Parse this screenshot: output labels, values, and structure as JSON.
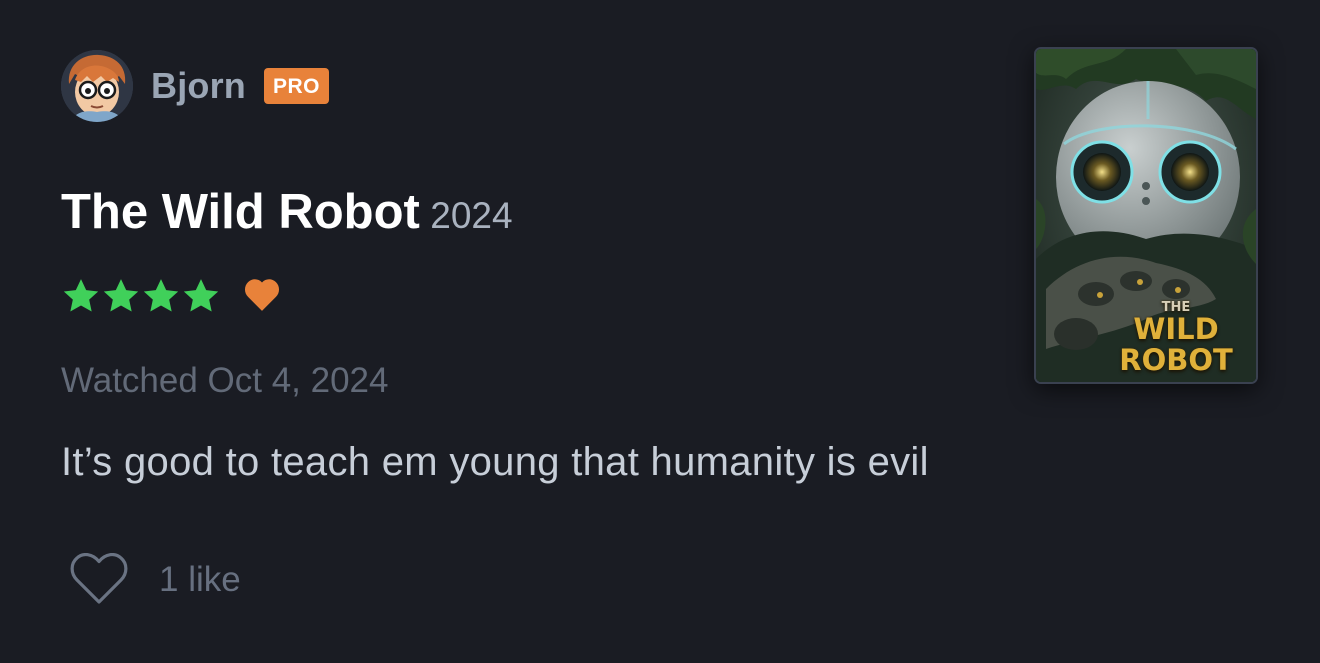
{
  "author": {
    "username": "Bjorn",
    "badge": "PRO",
    "avatar_icon": "avatar-cartoon-face",
    "badge_color": "#e8823a"
  },
  "film": {
    "title": "The Wild Robot",
    "year": "2024",
    "poster": {
      "title_line1": "THE",
      "title_line2": "WILD",
      "title_line3": "ROBOT"
    }
  },
  "rating": {
    "stars": 4,
    "max_stars": 5,
    "star_color": "#40d05a",
    "liked": true,
    "heart_color": "#e8823a"
  },
  "watched": {
    "text": "Watched Oct 4, 2024"
  },
  "review": {
    "body": "It’s good to teach em young that humanity is evil"
  },
  "likes": {
    "count_text": "1 like"
  },
  "colors": {
    "background": "#1a1c23",
    "username": "#9aa5b4",
    "muted": "#626a78"
  }
}
